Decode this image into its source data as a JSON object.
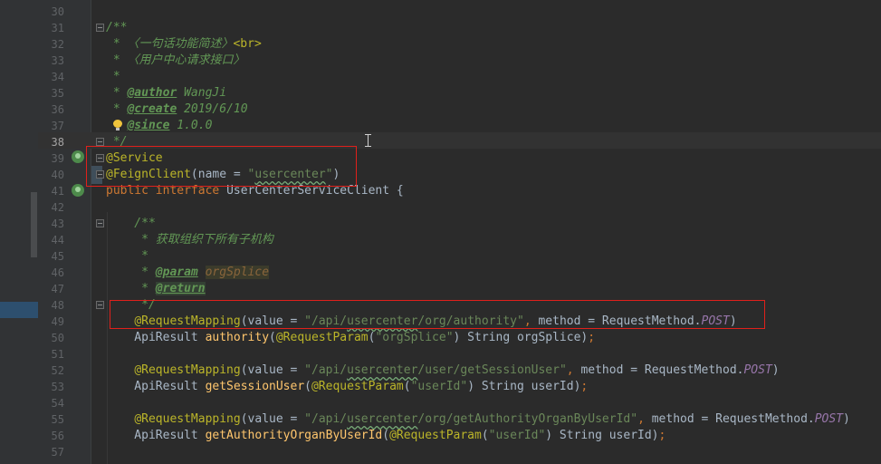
{
  "editor": {
    "current_line": "38",
    "lines": [
      {
        "n": "30",
        "segs": []
      },
      {
        "n": "31",
        "segs": [
          {
            "t": "/**",
            "c": "doc"
          }
        ]
      },
      {
        "n": "32",
        "segs": [
          {
            "t": " * 〈一句话功能简述〉",
            "c": "doc"
          },
          {
            "t": "<br>",
            "c": "ann"
          }
        ]
      },
      {
        "n": "33",
        "segs": [
          {
            "t": " * 〈用户中心请求接口〉",
            "c": "doc"
          }
        ]
      },
      {
        "n": "34",
        "segs": [
          {
            "t": " *",
            "c": "doc"
          }
        ]
      },
      {
        "n": "35",
        "segs": [
          {
            "t": " * ",
            "c": "doc"
          },
          {
            "t": "@author",
            "c": "doctag"
          },
          {
            "t": " WangJi",
            "c": "doc"
          }
        ]
      },
      {
        "n": "36",
        "segs": [
          {
            "t": " * ",
            "c": "doc"
          },
          {
            "t": "@create",
            "c": "doctag"
          },
          {
            "t": " 2019/6/10",
            "c": "doc"
          }
        ]
      },
      {
        "n": "37",
        "segs": [
          {
            "t": "   ",
            "c": "doc"
          },
          {
            "t": "@since",
            "c": "doctag"
          },
          {
            "t": " 1.0.0",
            "c": "doc"
          }
        ]
      },
      {
        "n": "38",
        "segs": [
          {
            "t": " */",
            "c": "doc"
          }
        ]
      },
      {
        "n": "39",
        "segs": [
          {
            "t": "@Service",
            "c": "ann"
          }
        ]
      },
      {
        "n": "40",
        "segs": [
          {
            "t": "@FeignClient",
            "c": "ann"
          },
          {
            "t": "(name = ",
            "c": "plain"
          },
          {
            "t": "\"",
            "c": "str"
          },
          {
            "t": "usercenter",
            "c": "str wavy"
          },
          {
            "t": "\"",
            "c": "str"
          },
          {
            "t": ")",
            "c": "plain"
          }
        ]
      },
      {
        "n": "41",
        "segs": [
          {
            "t": "public interface ",
            "c": "kw"
          },
          {
            "t": "UserCenterServiceClient {",
            "c": "plain"
          }
        ]
      },
      {
        "n": "42",
        "segs": []
      },
      {
        "n": "43",
        "segs": [
          {
            "t": "    /**",
            "c": "doc"
          }
        ]
      },
      {
        "n": "44",
        "segs": [
          {
            "t": "     * 获取组织下所有子机构",
            "c": "doc"
          }
        ]
      },
      {
        "n": "45",
        "segs": [
          {
            "t": "     *",
            "c": "doc"
          }
        ]
      },
      {
        "n": "46",
        "segs": [
          {
            "t": "     * ",
            "c": "doc"
          },
          {
            "t": "@param",
            "c": "doctag"
          },
          {
            "t": " ",
            "c": "doc"
          },
          {
            "t": "orgSplice",
            "c": "docparam"
          }
        ]
      },
      {
        "n": "47",
        "segs": [
          {
            "t": "     * ",
            "c": "doc"
          },
          {
            "t": "@return",
            "c": "doctag docret"
          }
        ]
      },
      {
        "n": "48",
        "segs": [
          {
            "t": "     */",
            "c": "doc"
          }
        ]
      },
      {
        "n": "49",
        "segs": [
          {
            "t": "    ",
            "c": "plain"
          },
          {
            "t": "@RequestMapping",
            "c": "ann"
          },
          {
            "t": "(value = ",
            "c": "plain"
          },
          {
            "t": "\"/api/",
            "c": "str"
          },
          {
            "t": "usercenter",
            "c": "str wavy"
          },
          {
            "t": "/org/authority\"",
            "c": "str"
          },
          {
            "t": ", ",
            "c": "kw"
          },
          {
            "t": "method = RequestMethod.",
            "c": "plain"
          },
          {
            "t": "POST",
            "c": "const"
          },
          {
            "t": ")",
            "c": "plain"
          }
        ]
      },
      {
        "n": "50",
        "segs": [
          {
            "t": "    ApiResult ",
            "c": "plain"
          },
          {
            "t": "authority",
            "c": "fn"
          },
          {
            "t": "(",
            "c": "plain"
          },
          {
            "t": "@RequestParam",
            "c": "ann"
          },
          {
            "t": "(",
            "c": "plain"
          },
          {
            "t": "\"orgSplice\"",
            "c": "str"
          },
          {
            "t": ") String orgSplice)",
            "c": "plain"
          },
          {
            "t": ";",
            "c": "kw"
          }
        ]
      },
      {
        "n": "51",
        "segs": []
      },
      {
        "n": "52",
        "segs": [
          {
            "t": "    ",
            "c": "plain"
          },
          {
            "t": "@RequestMapping",
            "c": "ann"
          },
          {
            "t": "(value = ",
            "c": "plain"
          },
          {
            "t": "\"/api/",
            "c": "str"
          },
          {
            "t": "usercenter",
            "c": "str wavy"
          },
          {
            "t": "/user/getSessionUser\"",
            "c": "str"
          },
          {
            "t": ", ",
            "c": "kw"
          },
          {
            "t": "method = RequestMethod.",
            "c": "plain"
          },
          {
            "t": "POST",
            "c": "const"
          },
          {
            "t": ")",
            "c": "plain"
          }
        ]
      },
      {
        "n": "53",
        "segs": [
          {
            "t": "    ApiResult ",
            "c": "plain"
          },
          {
            "t": "getSessionUser",
            "c": "fn"
          },
          {
            "t": "(",
            "c": "plain"
          },
          {
            "t": "@RequestParam",
            "c": "ann"
          },
          {
            "t": "(",
            "c": "plain"
          },
          {
            "t": "\"userId\"",
            "c": "str"
          },
          {
            "t": ") String userId)",
            "c": "plain"
          },
          {
            "t": ";",
            "c": "kw"
          }
        ]
      },
      {
        "n": "54",
        "segs": []
      },
      {
        "n": "55",
        "segs": [
          {
            "t": "    ",
            "c": "plain"
          },
          {
            "t": "@RequestMapping",
            "c": "ann"
          },
          {
            "t": "(value = ",
            "c": "plain"
          },
          {
            "t": "\"/api/",
            "c": "str"
          },
          {
            "t": "usercenter",
            "c": "str wavy"
          },
          {
            "t": "/org/getAuthorityOrganByUserId\"",
            "c": "str"
          },
          {
            "t": ", ",
            "c": "kw"
          },
          {
            "t": "method = RequestMethod.",
            "c": "plain"
          },
          {
            "t": "POST",
            "c": "const"
          },
          {
            "t": ")",
            "c": "plain"
          }
        ]
      },
      {
        "n": "56",
        "segs": [
          {
            "t": "    ApiResult ",
            "c": "plain"
          },
          {
            "t": "getAuthorityOrganByUserId",
            "c": "fn"
          },
          {
            "t": "(",
            "c": "plain"
          },
          {
            "t": "@RequestParam",
            "c": "ann"
          },
          {
            "t": "(",
            "c": "plain"
          },
          {
            "t": "\"userId\"",
            "c": "str"
          },
          {
            "t": ") String userId)",
            "c": "plain"
          },
          {
            "t": ";",
            "c": "kw"
          }
        ]
      },
      {
        "n": "57",
        "segs": []
      }
    ]
  },
  "colors": {
    "annotation": "#bbb529",
    "keyword": "#cc7832",
    "string": "#6a8759",
    "doc_comment": "#629755",
    "highlight_box": "#e0201b"
  },
  "icons": [
    "spring-bean-icon",
    "interface-implemented-icon",
    "intention-bulb-icon",
    "fold-icon",
    "text-cursor-icon"
  ]
}
